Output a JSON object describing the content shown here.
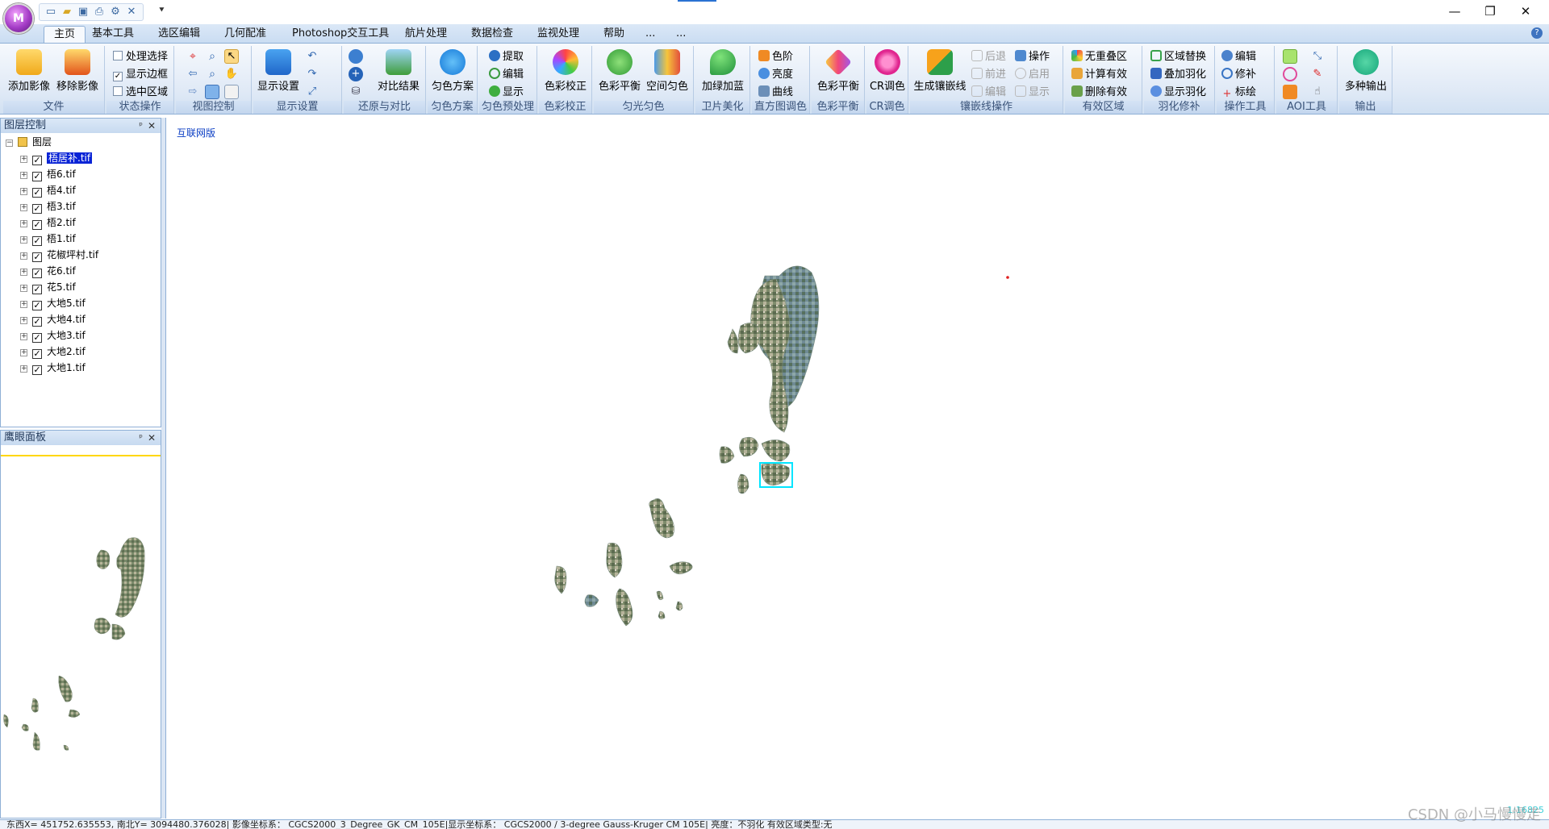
{
  "title_bar": {
    "logo_text": "M",
    "qat_more": "⯆",
    "controls": [
      "—",
      "❐",
      "✕"
    ]
  },
  "tabs": [
    "主页",
    "基本工具",
    "选区编辑",
    "几何配准",
    "Photoshop交互工具",
    "航片处理",
    "数据检查",
    "监视处理",
    "帮助",
    "...",
    "..."
  ],
  "ribbon": {
    "file": {
      "add": "添加影像",
      "remove": "移除影像",
      "label": "文件"
    },
    "state": {
      "opt1": "处理选择",
      "opt2": "显示边框",
      "opt3": "选中区域",
      "label": "状态操作"
    },
    "view": {
      "label": "视图控制"
    },
    "display": {
      "btn": "显示设置",
      "label": "显示设置"
    },
    "restore": {
      "btn": "对比结果",
      "label": "还原与对比"
    },
    "scheme": {
      "btn": "匀色方案",
      "label": "匀色方案"
    },
    "preproc": {
      "a": "提取",
      "b": "编辑",
      "c": "显示",
      "label": "匀色预处理"
    },
    "colorcorr": {
      "btn": "色彩校正",
      "label": "色彩校正"
    },
    "uniform": {
      "a": "色彩平衡",
      "b": "空间匀色",
      "label": "匀光匀色"
    },
    "satellite": {
      "btn": "加绿加蓝",
      "label": "卫片美化"
    },
    "histogram": {
      "a": "色阶",
      "b": "亮度",
      "c": "曲线",
      "label": "直方图调色"
    },
    "balance": {
      "btn": "色彩平衡",
      "label": "色彩平衡"
    },
    "cr": {
      "btn": "CR调色",
      "label": "CR调色"
    },
    "seam": {
      "btn": "生成镶嵌线",
      "a": "后退",
      "b": "前进",
      "c": "编辑",
      "d": "操作",
      "e": "启用",
      "f": "显示",
      "label": "镶嵌线操作"
    },
    "valid": {
      "a": "无重叠区",
      "b": "计算有效",
      "c": "删除有效",
      "label": "有效区域"
    },
    "feather": {
      "a": "区域替换",
      "b": "叠加羽化",
      "c": "显示羽化",
      "label": "羽化修补"
    },
    "optools": {
      "a": "编辑",
      "b": "修补",
      "c": "标绘",
      "label": "操作工具"
    },
    "aoi": {
      "label": "AOI工具"
    },
    "output": {
      "btn": "多种输出",
      "label": "输出"
    }
  },
  "layer_panel": {
    "title": "图层控制",
    "root": "图层",
    "layers": [
      "梧居补.tif",
      "梧6.tif",
      "梧4.tif",
      "梧3.tif",
      "梧2.tif",
      "梧1.tif",
      "花椒坪村.tif",
      "花6.tif",
      "花5.tif",
      "大地5.tif",
      "大地4.tif",
      "大地3.tif",
      "大地2.tif",
      "大地1.tif"
    ]
  },
  "eye_panel": {
    "title": "鹰眼面板"
  },
  "map": {
    "label": "互联网版",
    "scale": "1:16825"
  },
  "status": "东西X= 451752.635553, 南北Y= 3094480.376028| 影像坐标系： CGCS2000_3_Degree_GK_CM_105E|显示坐标系： CGCS2000 / 3-degree Gauss-Kruger CM 105E| 亮度：不羽化 有效区域类型:无",
  "watermark": "CSDN @小马慢慢走",
  "colors": {
    "accent": "#2a72d2",
    "panel_header": "#c7daf0",
    "selection": "#0a24d6",
    "highlight": "#00e5ff"
  }
}
